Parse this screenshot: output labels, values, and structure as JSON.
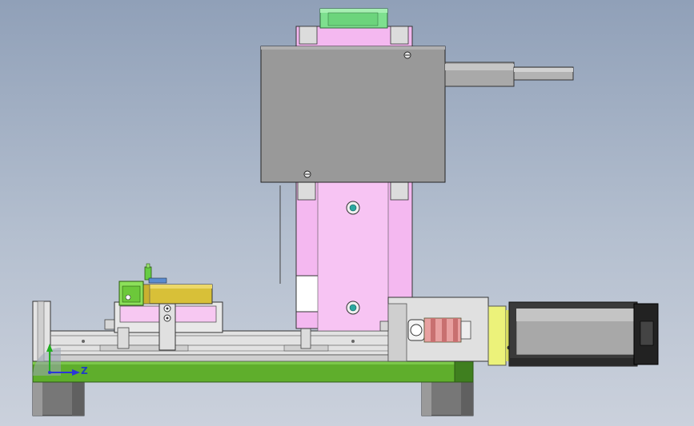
{
  "viewport": {
    "background_top": "#90a0b8",
    "background_bottom": "#cbd1dc"
  },
  "triad": {
    "z_axis_label": "Z",
    "x_axis_color": "#2b36d8",
    "y_axis_color": "#22b020",
    "z_axis_color": "#2b36d8"
  },
  "colors": {
    "carriage_pink": "#f4b8f0",
    "motor_block_gray": "#999999",
    "base_plate_green": "#5fae2c",
    "connector_green": "#7ee08f",
    "clamp_yellow": "#d8c038",
    "motor_yellow": "#ecf27a",
    "motor_black": "#222222"
  }
}
